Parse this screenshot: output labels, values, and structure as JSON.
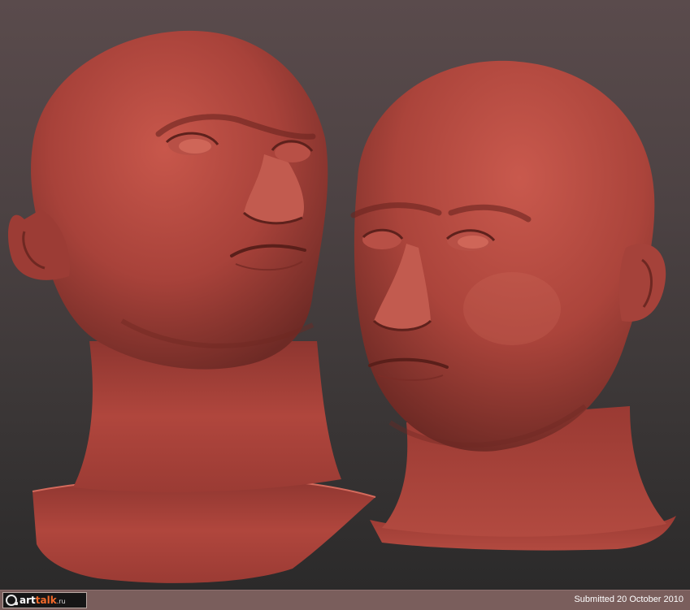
{
  "image": {
    "subject": "Two sculpted bald male head busts in terracotta clay material",
    "background_colors": [
      "#5a4b4c",
      "#2b2a2a"
    ],
    "clay_color": "#b3463e"
  },
  "footer": {
    "logo": {
      "part1": "art",
      "part2": "talk",
      "suffix": ".ru"
    },
    "submitted_text": "Submitted 20 October 2010",
    "bar_color": "#7a5e5c"
  }
}
